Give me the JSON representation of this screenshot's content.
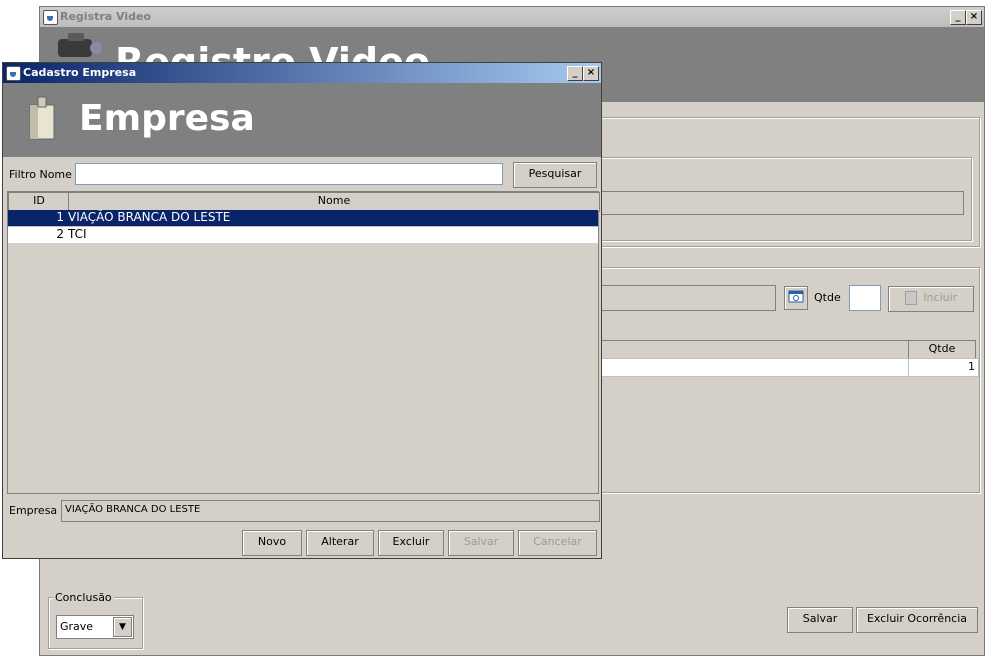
{
  "background_window": {
    "title": "Registra Video",
    "header_title": "Registro Video",
    "product_search": {
      "qty_label": "Qtde",
      "include_label": "Incluir"
    },
    "items_table": {
      "qty_header": "Qtde",
      "rows": [
        {
          "qty": "1"
        }
      ]
    },
    "conclusion": {
      "group_label": "Conclusão",
      "selected": "Grave"
    },
    "actions": {
      "save_label": "Salvar",
      "delete_label": "Excluir Ocorrência"
    }
  },
  "dialog": {
    "title": "Cadastro Empresa",
    "header_title": "Empresa",
    "filter": {
      "label": "Filtro Nome",
      "value": "",
      "search_label": "Pesquisar"
    },
    "table": {
      "headers": {
        "id": "ID",
        "name": "Nome"
      },
      "rows": [
        {
          "id": "1",
          "name": "VIAÇÃO BRANCA DO LESTE",
          "selected": true
        },
        {
          "id": "2",
          "name": "TCI",
          "selected": false
        }
      ]
    },
    "company": {
      "label": "Empresa",
      "value": "VIAÇÃO BRANCA DO LESTE"
    },
    "buttons": {
      "new": "Novo",
      "edit": "Alterar",
      "delete": "Excluir",
      "save": "Salvar",
      "cancel": "Cancelar"
    }
  },
  "colors": {
    "header_gray": "#808080",
    "selection": "#0a246a",
    "window_bg": "#d4d0c8"
  }
}
